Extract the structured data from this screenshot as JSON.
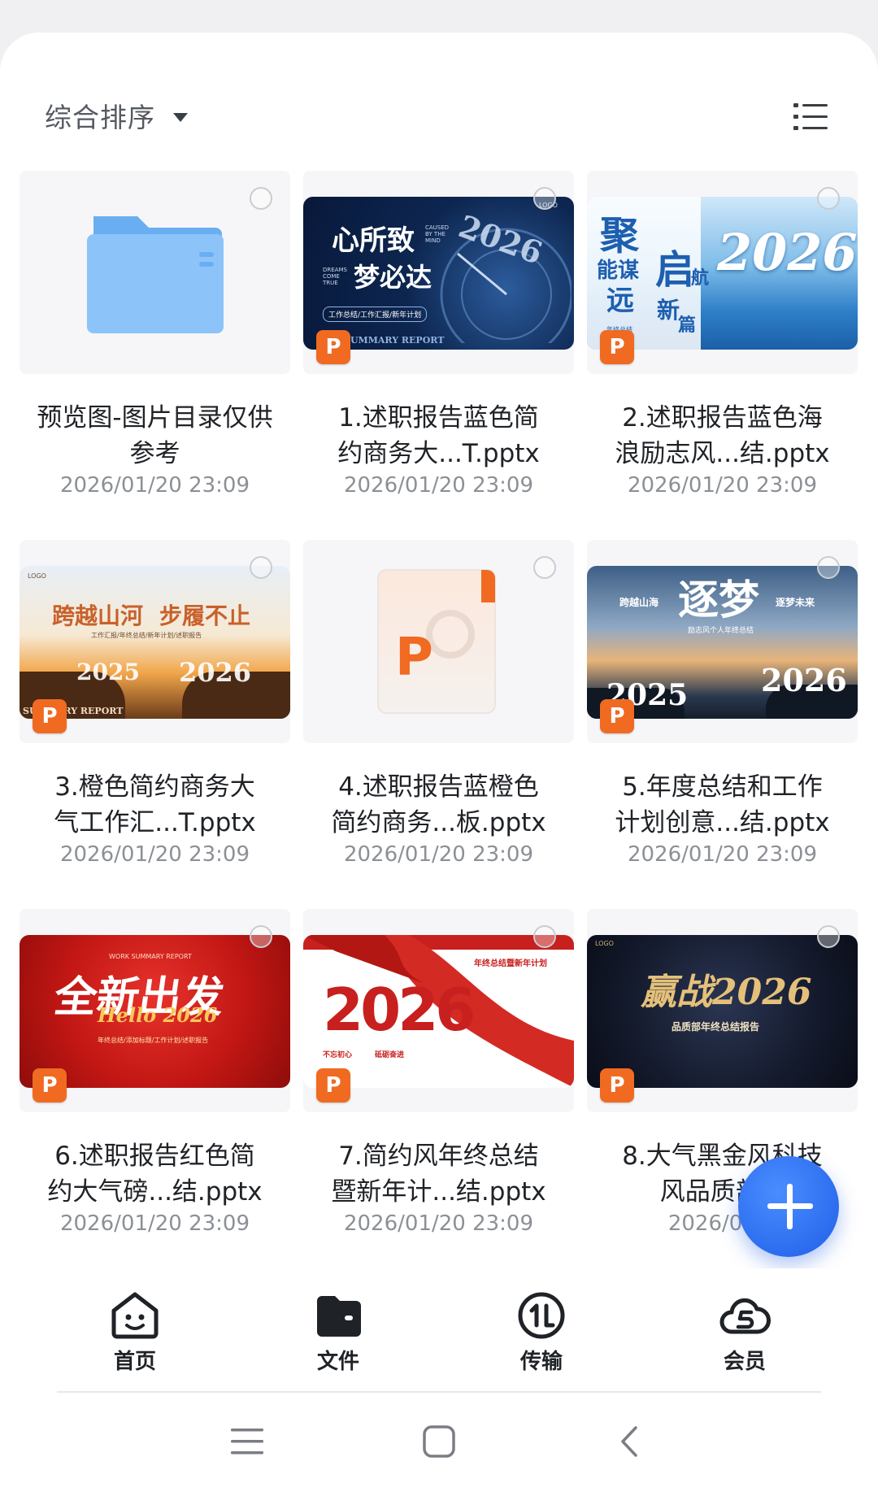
{
  "header": {
    "sort_label": "综合排序",
    "view_toggle_icon": "list-view-icon"
  },
  "files": [
    {
      "name": "预览图-图片目录仅供参考",
      "date": "2026/01/20 23:09",
      "type": "folder"
    },
    {
      "name": "1.述职报告蓝色简约商务大...T.pptx",
      "date": "2026/01/20 23:09",
      "type": "pptx",
      "thumb_text": [
        "心所致",
        "梦必达",
        "DREAMS COME TRUE",
        "工作总结/工作汇报/新年计划",
        "2026",
        "LOGO",
        "CAUSED BY THE MIND",
        "SUMMARY REPORT"
      ]
    },
    {
      "name": "2.述职报告蓝色海浪励志风...结.pptx",
      "date": "2026/01/20 23:09",
      "type": "pptx",
      "thumb_text": [
        "聚",
        "能谋",
        "启",
        "航",
        "远",
        "新",
        "篇",
        "2026",
        "年终总结"
      ]
    },
    {
      "name": "3.橙色简约商务大气工作汇...T.pptx",
      "date": "2026/01/20 23:09",
      "type": "pptx",
      "thumb_text": [
        "跨越山河",
        "步履不止",
        "工作汇报/年终总结/新年计划/述职报告",
        "2025",
        "2026",
        "LOGO",
        "SUMMARY REPORT"
      ]
    },
    {
      "name": "4.述职报告蓝橙色简约商务...板.pptx",
      "date": "2026/01/20 23:09",
      "type": "pptx-generic"
    },
    {
      "name": "5.年度总结和工作计划创意...结.pptx",
      "date": "2026/01/20 23:09",
      "type": "pptx",
      "thumb_text": [
        "跨越山海",
        "逐梦",
        "逐梦未来",
        "励志风个人年终总结",
        "2025",
        "2026"
      ]
    },
    {
      "name": "6.述职报告红色简约大气磅...结.pptx",
      "date": "2026/01/20 23:09",
      "type": "pptx",
      "thumb_text": [
        "WORK SUMMARY REPORT",
        "全新出发",
        "Hello 2026",
        "年终总结/添加标题/工作计划/述职报告"
      ]
    },
    {
      "name": "7.简约风年终总结暨新年计...结.pptx",
      "date": "2026/01/20 23:09",
      "type": "pptx",
      "thumb_text": [
        "年终总结暨新年计划",
        "2026",
        "不忘初心",
        "砥砺奋进"
      ]
    },
    {
      "name": "8.大气黑金风科技风品质部...",
      "date": "2026/01/2",
      "type": "pptx",
      "thumb_text": [
        "赢战2026",
        "品质部年终总结报告",
        "LOGO"
      ]
    }
  ],
  "tabs": [
    {
      "label": "首页",
      "icon": "home-smile-icon"
    },
    {
      "label": "文件",
      "icon": "folder-wallet-icon"
    },
    {
      "label": "传输",
      "icon": "transfer-icon"
    },
    {
      "label": "会员",
      "icon": "vip-cloud-icon"
    }
  ],
  "fab": {
    "icon": "plus-icon"
  },
  "nav": {
    "menu_icon": "menu-icon",
    "home_icon": "home-square-icon",
    "back_icon": "back-chevron-icon"
  },
  "colors": {
    "accent": "#2a6cf0",
    "ppt_badge": "#f06a21",
    "text": "#1f2226",
    "muted": "#8c9096"
  }
}
